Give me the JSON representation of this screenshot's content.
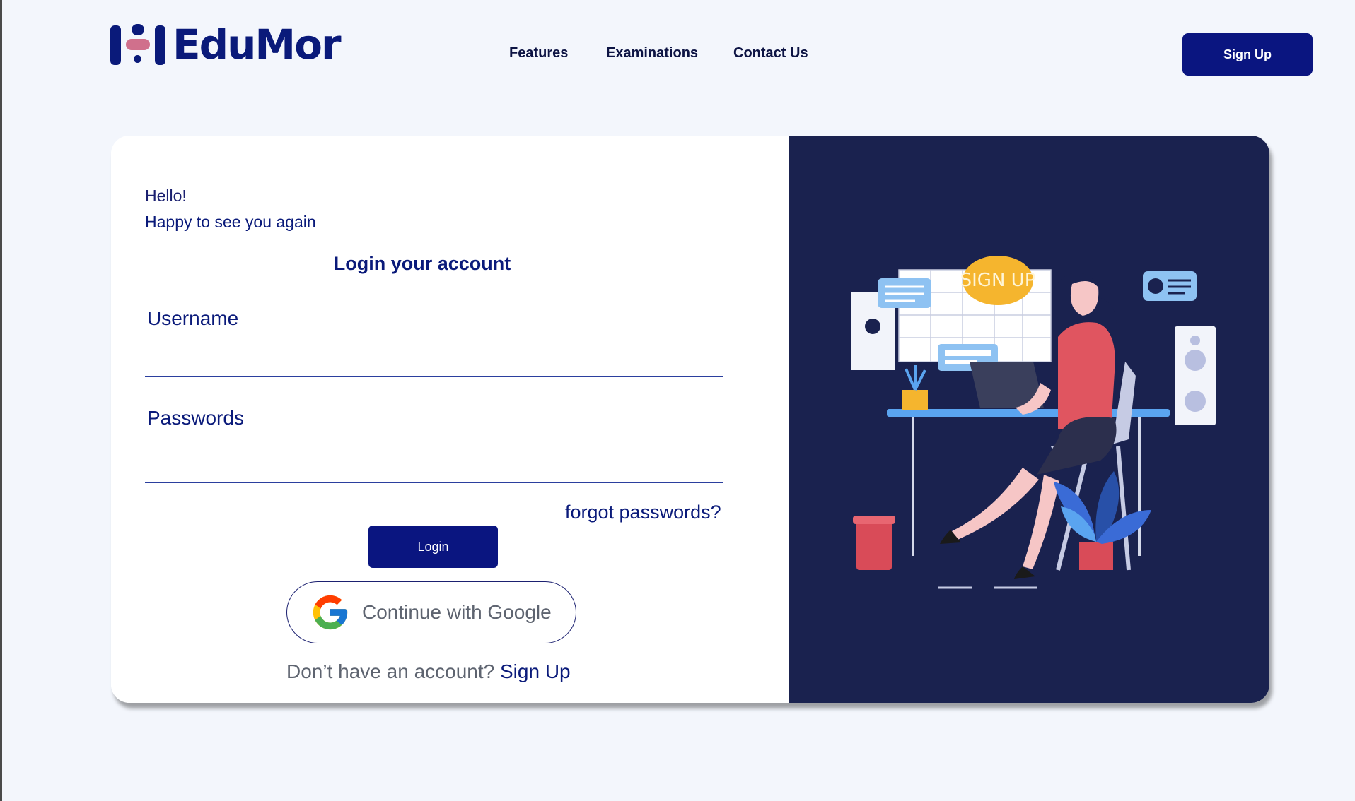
{
  "brand": {
    "name": "EduMor"
  },
  "nav": {
    "features": "Features",
    "examinations": "Examinations",
    "contact": "Contact Us"
  },
  "header": {
    "signup_label": "Sign Up"
  },
  "login": {
    "greeting": "Hello!",
    "subgreeting": "Happy to see you again",
    "title": "Login your account",
    "username_label": "Username",
    "username_value": "",
    "password_label": "Passwords",
    "password_value": "",
    "forgot_label": "forgot passwords?",
    "login_label": "Login",
    "google_label": "Continue with Google",
    "no_account_text": "Don’t have an account?",
    "signup_link": "Sign Up"
  },
  "illustration": {
    "bubble_text": "SIGN UP",
    "icons": [
      "google-icon",
      "chat-bubble-icon",
      "id-card-icon",
      "speaker-icon",
      "plant-icon",
      "cup-icon"
    ]
  },
  "colors": {
    "primary": "#0a1580",
    "brand": "#0a1a7a",
    "panel": "#1a224f",
    "background": "#f3f6fc",
    "accent_pink": "#d0708c"
  }
}
